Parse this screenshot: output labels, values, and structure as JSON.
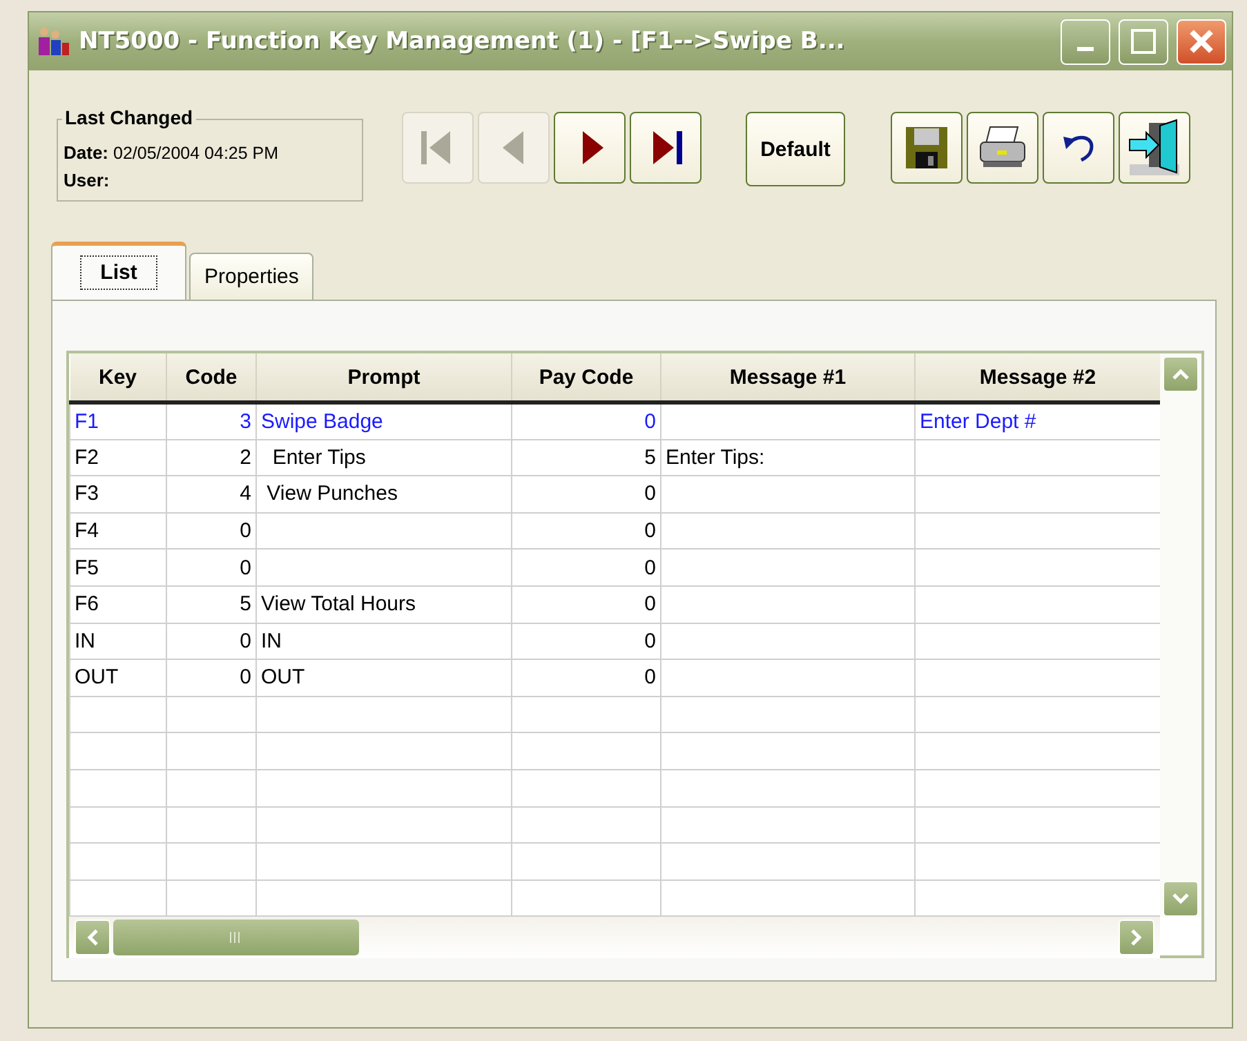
{
  "window": {
    "title": "NT5000 - Function Key Management (1) - [F1-->Swipe B..."
  },
  "last_changed": {
    "title": "Last Changed",
    "date_label": "Date:",
    "date": "02/05/2004 04:25 PM",
    "user_label": "User:"
  },
  "nav_buttons": [
    {
      "kind": "first",
      "disabled": true
    },
    {
      "kind": "previous",
      "disabled": true
    },
    {
      "kind": "next",
      "disabled": false
    },
    {
      "kind": "last",
      "disabled": false
    }
  ],
  "default_button": {
    "label": "Default"
  },
  "action_buttons": [
    {
      "kind": "save"
    },
    {
      "kind": "print"
    },
    {
      "kind": "undo"
    },
    {
      "kind": "exit"
    }
  ],
  "tabs": [
    {
      "label": "List",
      "selected": true
    },
    {
      "label": "Properties",
      "selected": false
    }
  ],
  "table": {
    "columns": [
      {
        "label": "Key",
        "kind": "text"
      },
      {
        "label": "Code",
        "kind": "number"
      },
      {
        "label": "Prompt",
        "kind": "text"
      },
      {
        "label": "Pay Code",
        "kind": "number"
      },
      {
        "label": "Message #1",
        "kind": "text"
      },
      {
        "label": "Message #2",
        "kind": "text"
      }
    ],
    "rows": [
      {
        "key": "F1",
        "code": "3",
        "prompt": "Swipe Badge",
        "pay_code": "0",
        "message_2": "Enter Dept #",
        "selected": true
      },
      {
        "key": "F2",
        "code": "2",
        "prompt": "  Enter Tips",
        "pay_code": "5",
        "message_1": "Enter Tips:",
        "selected": false
      },
      {
        "key": "F3",
        "code": "4",
        "prompt": " View Punches",
        "pay_code": "0",
        "selected": false
      },
      {
        "key": "F4",
        "code": "0",
        "pay_code": "0",
        "selected": false
      },
      {
        "key": "F5",
        "code": "0",
        "pay_code": "0",
        "selected": false
      },
      {
        "key": "F6",
        "code": "5",
        "prompt": "View Total Hours",
        "pay_code": "0",
        "selected": false
      },
      {
        "key": "IN",
        "code": "0",
        "prompt": "IN",
        "pay_code": "0",
        "selected": false
      },
      {
        "key": "OUT",
        "code": "0",
        "prompt": "OUT",
        "pay_code": "0",
        "selected": false
      }
    ]
  }
}
